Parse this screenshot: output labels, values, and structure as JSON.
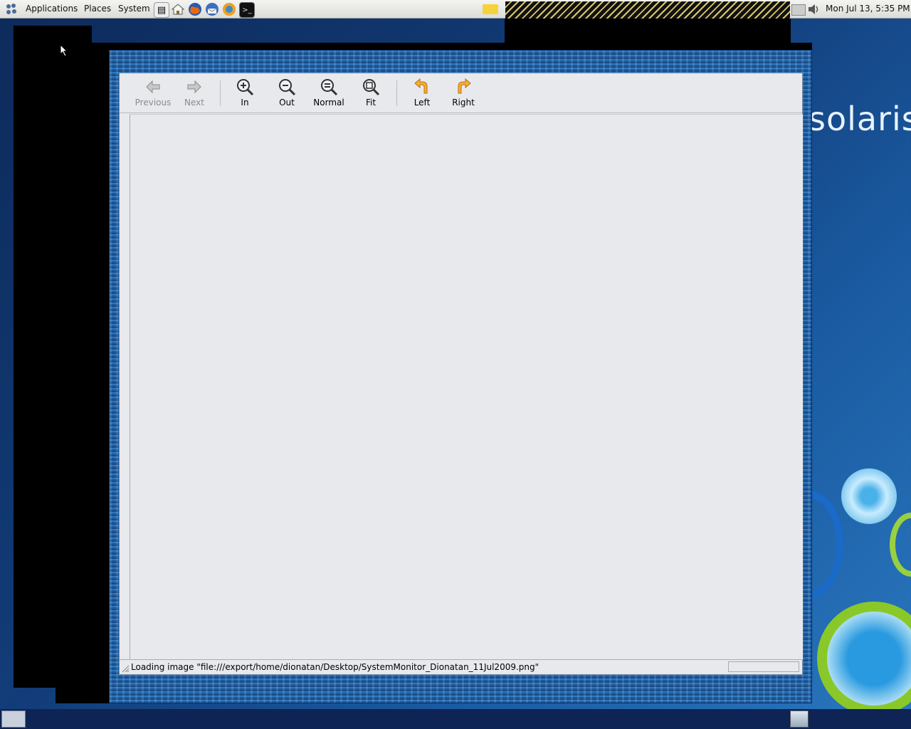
{
  "top_panel": {
    "menus": [
      "Applications",
      "Places",
      "System"
    ],
    "launchers": [
      "notes-icon",
      "home-icon",
      "firefox-icon",
      "thunderbird-icon",
      "update-icon",
      "terminal-icon"
    ],
    "clock": "Mon Jul 13,  5:35 PM"
  },
  "desktop": {
    "logo_text": "solaris"
  },
  "viewer_window": {
    "toolbar": {
      "previous": "Previous",
      "next": "Next",
      "zoom_in": "In",
      "zoom_out": "Out",
      "zoom_normal": "Normal",
      "zoom_fit": "Fit",
      "rotate_left": "Left",
      "rotate_right": "Right"
    },
    "status": "Loading image \"file:///export/home/dionatan/Desktop/SystemMonitor_Dionatan_11Jul2009.png\""
  },
  "colors": {
    "panel": "#dcdcd8",
    "window_frame": "#1c5a9e",
    "client_bg": "#e8e9ec",
    "rotate_arrow": "#f0a020"
  }
}
